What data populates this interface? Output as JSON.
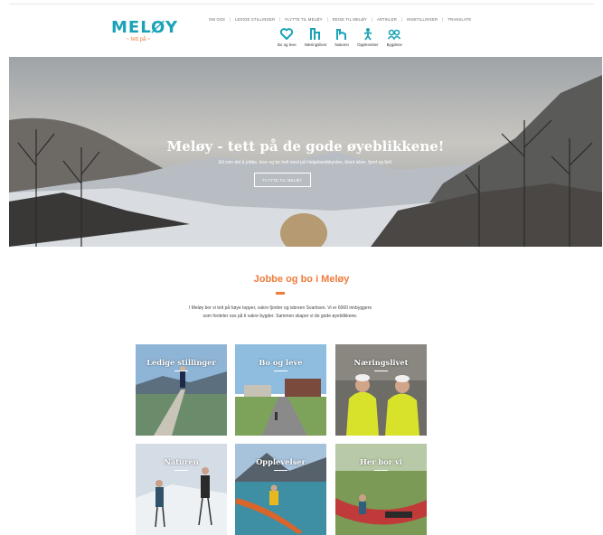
{
  "logo": {
    "text": "MELØY",
    "tagline": "~ tett på ~"
  },
  "top_nav": [
    "OM OSS",
    "LEDIGE STILLINGER",
    "FLYTTE TIL MELØY",
    "REISE TIL MELØY",
    "ARTIKLER",
    "INNSTILLINGER",
    "TRANSLATE"
  ],
  "icon_nav": [
    {
      "label": "Bo og leve",
      "icon": "heart-icon"
    },
    {
      "label": "Næringslivet",
      "icon": "building-icon"
    },
    {
      "label": "Naturen",
      "icon": "mountain-icon"
    },
    {
      "label": "Opplevelser",
      "icon": "person-icon"
    },
    {
      "label": "Bygdene",
      "icon": "people-icon"
    }
  ],
  "hero": {
    "title": "Meløy - tett på de gode øyeblikkene!",
    "subtitle": "Ett rom det å jobbe, leve og bo helt nord på Helgelandskysten, blant isbre, fjord og fjell.",
    "button": "FLYTTE TIL MELØY"
  },
  "section": {
    "title": "Jobbe og bo i Meløy",
    "text": "I Meløy bor vi tett på høye topper, vakre fjorder og isbreen Svartisen. Vi er 6000 innbyggere som fordeler oss på ti vakre bygder. Sammen skaper vi de gode øyeblikkene."
  },
  "tiles": [
    {
      "label": "Ledige stillinger"
    },
    {
      "label": "Bo og leve"
    },
    {
      "label": "Næringslivet"
    },
    {
      "label": "Naturen"
    },
    {
      "label": "Opplevelser"
    },
    {
      "label": "Her bor vi"
    }
  ],
  "colors": {
    "brand_teal": "#1aa3b7",
    "accent_orange": "#ef7b3c"
  }
}
